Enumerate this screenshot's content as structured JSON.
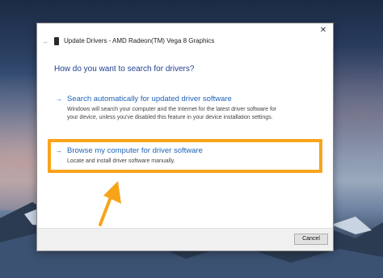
{
  "window": {
    "back_glyph": "←",
    "title": "Update Drivers - AMD Radeon(TM) Vega 8 Graphics",
    "close_glyph": "✕",
    "device_icon": "device-icon"
  },
  "main": {
    "heading": "How do you want to search for drivers?",
    "options": [
      {
        "arrow": "→",
        "title": "Search automatically for updated driver software",
        "desc_lines": [
          "Windows will search your computer and the Internet for the latest driver software for",
          "your device, unless you've disabled this feature in your device installation settings."
        ]
      },
      {
        "arrow": "→",
        "title": "Browse my computer for driver software",
        "desc_lines": [
          "Locate and install driver software manually."
        ]
      }
    ]
  },
  "footer": {
    "cancel_label": "Cancel"
  },
  "colors": {
    "accent_link": "#1e63b8",
    "heading": "#1f3f8f",
    "highlight": "#f7a41b"
  }
}
